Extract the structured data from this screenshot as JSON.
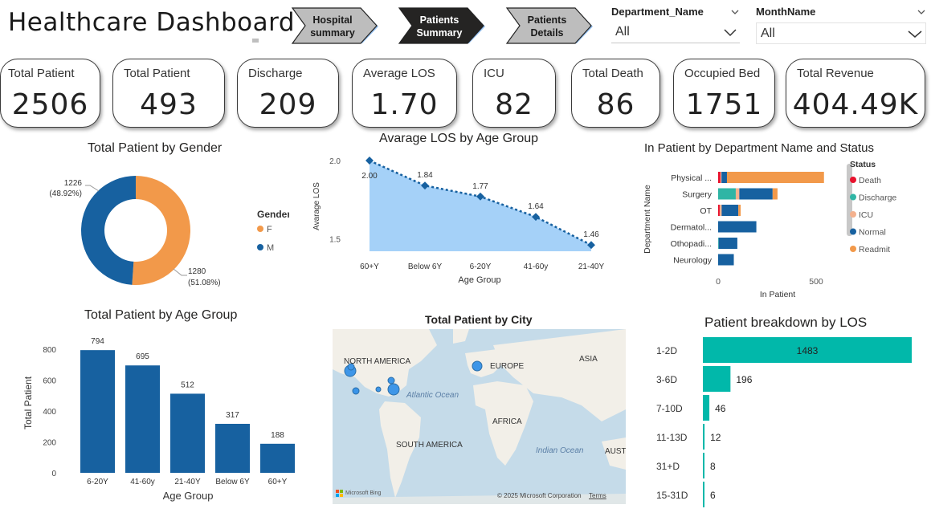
{
  "header": {
    "title": "Healthcare Dashboard"
  },
  "nav": {
    "hospital_summary": "Hospital summary",
    "patients_summary": "Patients Summary",
    "patients_details": "Patients Details"
  },
  "slicers": {
    "department": {
      "label": "Department_Name",
      "value": "All"
    },
    "month": {
      "label": "MonthName",
      "value": "All"
    }
  },
  "kpis": [
    {
      "label": "Total Patient",
      "value": "2506"
    },
    {
      "label": "Total Patient",
      "value": "493"
    },
    {
      "label": "Discharge",
      "value": "209"
    },
    {
      "label": "Average LOS",
      "value": "1.70"
    },
    {
      "label": "ICU",
      "value": "82"
    },
    {
      "label": "Total Death",
      "value": "86"
    },
    {
      "label": "Occupied Bed",
      "value": "1751"
    },
    {
      "label": "Total Revenue",
      "value": "404.49K"
    }
  ],
  "colors": {
    "blue": "#1761a0",
    "orange": "#f2994a",
    "teal": "#2fb5a5",
    "red": "#e8122d",
    "salmon": "#f4b18e",
    "area": "#a5d1f8",
    "los_teal": "#01b8aa",
    "map_water": "#c5dbe9",
    "map_land": "#f2efe8"
  },
  "chart_data": [
    {
      "type": "pie",
      "title": "Total Patient by Gender",
      "legend_title": "Gender",
      "slices": [
        {
          "name": "F",
          "value": 1280,
          "pct": "51.08%"
        },
        {
          "name": "M",
          "value": 1226,
          "pct": "48.92%"
        }
      ]
    },
    {
      "type": "area",
      "title": "Avarage LOS by Age Group",
      "xlabel": "Age Group",
      "ylabel": "Avarage LOS",
      "categories": [
        "60+Y",
        "Below 6Y",
        "6-20Y",
        "41-60y",
        "21-40Y"
      ],
      "values": [
        2.0,
        1.84,
        1.77,
        1.64,
        1.46
      ],
      "value_labels": [
        "2.00",
        "1.84",
        "1.77",
        "1.64",
        "1.46"
      ],
      "yticks": [
        "2.0",
        "1.5"
      ],
      "ylim": [
        1.42,
        2.0
      ]
    },
    {
      "type": "bar",
      "orientation": "horizontal",
      "stacked": true,
      "title": "In Patient by Department Name and Status",
      "xlabel": "In Patient",
      "ylabel": "Department Name",
      "legend_title": "Status",
      "categories": [
        "Physical ...",
        "Surgery",
        "OT",
        "Dermatol...",
        "Othopadi...",
        "Neurology"
      ],
      "series": [
        {
          "name": "Death",
          "values": [
            12,
            0,
            8,
            0,
            0,
            0
          ]
        },
        {
          "name": "Discharge",
          "values": [
            0,
            90,
            0,
            0,
            3,
            0
          ]
        },
        {
          "name": "ICU",
          "values": [
            5,
            18,
            10,
            0,
            0,
            0
          ]
        },
        {
          "name": "Normal",
          "values": [
            28,
            170,
            85,
            195,
            95,
            80
          ]
        },
        {
          "name": "Readmit",
          "values": [
            495,
            25,
            12,
            0,
            0,
            0
          ]
        }
      ],
      "xticks": [
        "0",
        "500"
      ],
      "xlim": [
        0,
        640
      ]
    },
    {
      "type": "bar",
      "title": "Total Patient by Age Group",
      "xlabel": "Age Group",
      "ylabel": "Total Patient",
      "categories": [
        "6-20Y",
        "41-60y",
        "21-40Y",
        "Below 6Y",
        "60+Y"
      ],
      "values": [
        794,
        695,
        512,
        317,
        188
      ],
      "value_labels": [
        "794",
        "695",
        "512",
        "317",
        "188"
      ],
      "yticks": [
        "800",
        "600",
        "400",
        "200",
        "0"
      ],
      "ylim": [
        0,
        800
      ]
    },
    {
      "type": "bar",
      "orientation": "horizontal",
      "title": "Patient breakdown by LOS",
      "categories": [
        "1-2D",
        "3-6D",
        "7-10D",
        "11-13D",
        "31+D",
        "15-31D"
      ],
      "values": [
        1483,
        196,
        46,
        12,
        8,
        6
      ],
      "value_labels": [
        "1483",
        "196",
        "46",
        "12",
        "8",
        "6"
      ]
    }
  ],
  "map": {
    "title": "Total Patient by City",
    "labels": {
      "north_america": "NORTH AMERICA",
      "europe": "EUROPE",
      "asia": "ASIA",
      "africa": "AFRICA",
      "south_america": "SOUTH AMERICA",
      "austr": "AUSTI",
      "atlantic": "Atlantic Ocean",
      "indian": "Indian Ocean"
    },
    "bing": "Microsoft Bing",
    "copyright": "© 2025 Microsoft Corporation",
    "terms": "Terms"
  }
}
